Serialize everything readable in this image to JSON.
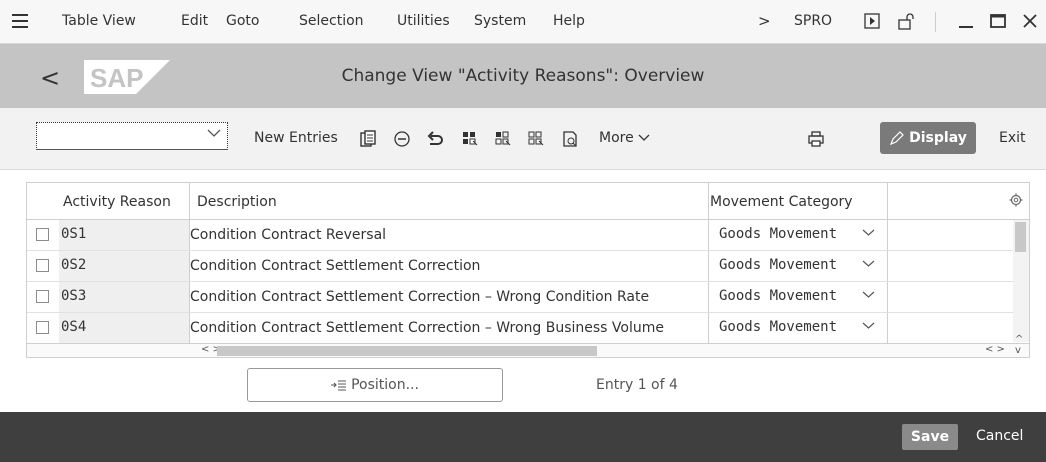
{
  "menu": {
    "items": [
      "Table View",
      "Edit",
      "Goto",
      "Selection",
      "Utilities",
      "System",
      "Help"
    ],
    "tcode": "SPRO"
  },
  "title": "Change View \"Activity Reasons\": Overview",
  "toolbar": {
    "new_entries": "New Entries",
    "more": "More",
    "display": "Display",
    "exit": "Exit"
  },
  "table": {
    "headers": [
      "Activity Reason",
      "Description",
      "Movement Category"
    ],
    "rows": [
      {
        "key": "0S1",
        "description": "Condition Contract Reversal",
        "category": "Goods Movement"
      },
      {
        "key": "0S2",
        "description": "Condition Contract Settlement Correction",
        "category": "Goods Movement"
      },
      {
        "key": "0S3",
        "description": "Condition Contract Settlement Correction – Wrong Condition Rate",
        "category": "Goods Movement"
      },
      {
        "key": "0S4",
        "description": "Condition Contract Settlement Correction – Wrong Business Volume",
        "category": "Goods Movement"
      }
    ]
  },
  "position_button": "Position...",
  "entry_info": "Entry 1 of 4",
  "footer": {
    "save": "Save",
    "cancel": "Cancel"
  }
}
